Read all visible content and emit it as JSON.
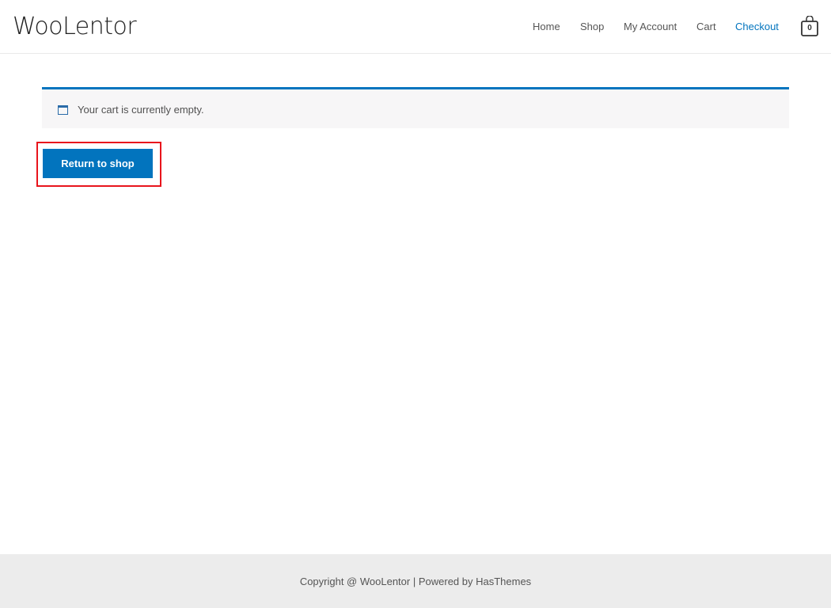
{
  "header": {
    "logo": "WooLentor",
    "nav": [
      "Home",
      "Shop",
      "My Account",
      "Cart",
      "Checkout"
    ],
    "active_nav": "Checkout",
    "cart_count": "0"
  },
  "notice": {
    "text": "Your cart is currently empty.",
    "icon": "window-icon"
  },
  "actions": {
    "return_label": "Return to shop"
  },
  "footer": {
    "prefix": "Copyright @ ",
    "brand": "WooLentor",
    "sep": " | ",
    "powered": "Powered by HasThemes"
  },
  "colors": {
    "accent": "#0274be",
    "highlight": "#e8141c",
    "footer_bg": "#ececec"
  }
}
